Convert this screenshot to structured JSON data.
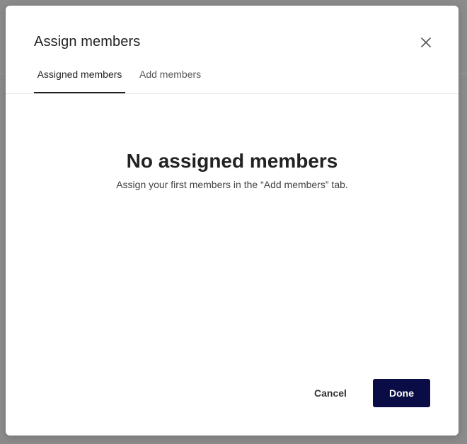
{
  "dialog": {
    "title": "Assign members",
    "close_icon": "close-icon"
  },
  "tabs": [
    {
      "label": "Assigned members",
      "active": true
    },
    {
      "label": "Add members",
      "active": false
    }
  ],
  "empty_state": {
    "heading": "No assigned members",
    "message": "Assign your first members in the “Add members” tab."
  },
  "footer": {
    "cancel_label": "Cancel",
    "done_label": "Done"
  },
  "colors": {
    "primary_button": "#0a0c45",
    "active_tab_indicator": "#1f1f1f",
    "backdrop": "#8b8b8b"
  }
}
